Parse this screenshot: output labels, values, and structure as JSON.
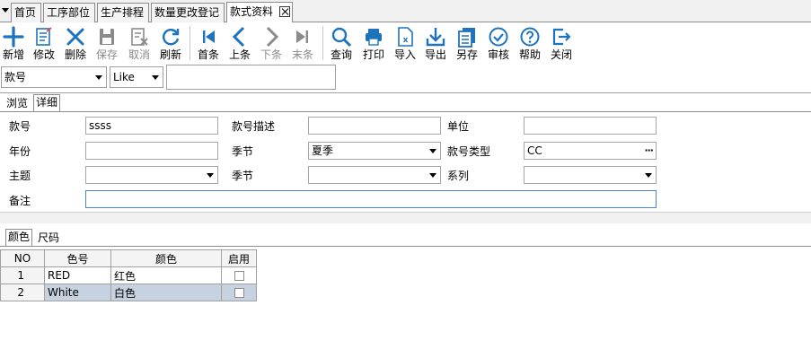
{
  "doc_tabs": [
    {
      "label": "首页",
      "active": false
    },
    {
      "label": "工序部位",
      "active": false
    },
    {
      "label": "生产排程",
      "active": false
    },
    {
      "label": "数量更改登记",
      "active": false
    },
    {
      "label": "款式资料",
      "active": true
    }
  ],
  "toolbar": {
    "new": "新增",
    "edit": "修改",
    "delete": "删除",
    "save": "保存",
    "cancel": "取消",
    "refresh": "刷新",
    "first": "首条",
    "prev": "上条",
    "next": "下条",
    "last": "末条",
    "query": "查询",
    "print": "打印",
    "import": "导入",
    "export": "导出",
    "save_as": "另存",
    "audit": "审核",
    "help": "帮助",
    "close": "关闭"
  },
  "search": {
    "field": "款号",
    "operator": "Like",
    "value": ""
  },
  "view_tabs": [
    "浏览",
    "详细"
  ],
  "form": {
    "style_no_label": "款号",
    "style_no_value": "ssss",
    "style_desc_label": "款号描述",
    "style_desc_value": "",
    "unit_label": "单位",
    "unit_value": "",
    "year_label": "年份",
    "year_value": "",
    "season_label": "季节",
    "season_value": "夏季",
    "style_type_label": "款号类型",
    "style_type_value": "CC",
    "theme_label": "主题",
    "theme_value": "",
    "season2_label": "季节",
    "season2_value": "",
    "series_label": "系列",
    "series_value": "",
    "remark_label": "备注",
    "remark_value": ""
  },
  "detail_tabs": [
    "颜色",
    "尺码"
  ],
  "grid": {
    "headers": [
      "NO",
      "色号",
      "颜色",
      "启用"
    ],
    "rows": [
      {
        "no": "1",
        "code": "RED",
        "color": "红色"
      },
      {
        "no": "2",
        "code": "White",
        "color": "白色"
      }
    ]
  },
  "colors": {
    "accent_blue": "#1e73be",
    "selected_row": "#c6d2e0"
  }
}
